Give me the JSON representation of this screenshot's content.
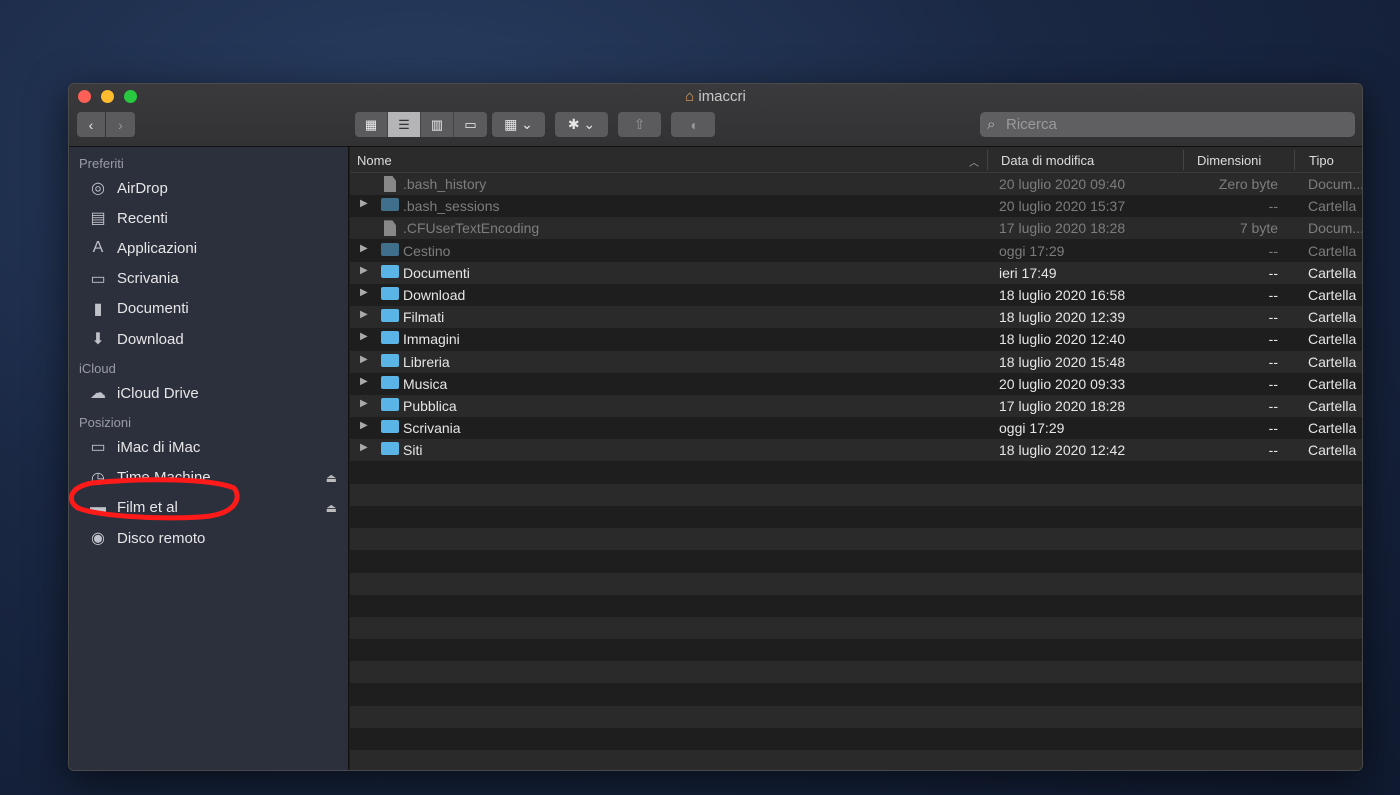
{
  "window": {
    "title": "imaccri",
    "icon": "home-icon"
  },
  "toolbar": {
    "back": "‹",
    "forward": "›",
    "views": [
      "icon-view-icon",
      "list-view-icon",
      "column-view-icon",
      "gallery-view-icon"
    ],
    "group": "group-icon",
    "action": "gear-icon",
    "share": "share-icon",
    "tag": "tag-icon",
    "search_placeholder": "Ricerca"
  },
  "sidebar": {
    "sections": [
      {
        "title": "Preferiti",
        "items": [
          {
            "label": "AirDrop",
            "icon": "airdrop-icon"
          },
          {
            "label": "Recenti",
            "icon": "recent-icon"
          },
          {
            "label": "Applicazioni",
            "icon": "applications-icon"
          },
          {
            "label": "Scrivania",
            "icon": "desktop-icon"
          },
          {
            "label": "Documenti",
            "icon": "document-icon"
          },
          {
            "label": "Download",
            "icon": "download-icon"
          }
        ]
      },
      {
        "title": "iCloud",
        "items": [
          {
            "label": "iCloud Drive",
            "icon": "cloud-icon"
          }
        ]
      },
      {
        "title": "Posizioni",
        "items": [
          {
            "label": "iMac di iMac",
            "icon": "imac-icon"
          },
          {
            "label": "Time Machine",
            "icon": "time-machine-icon",
            "eject": true
          },
          {
            "label": "Film et al",
            "icon": "drive-icon",
            "eject": true
          },
          {
            "label": "Disco remoto",
            "icon": "disc-icon"
          }
        ]
      }
    ]
  },
  "columns": {
    "name": "Nome",
    "date": "Data di modifica",
    "size": "Dimensioni",
    "kind": "Tipo"
  },
  "files": [
    {
      "name": ".bash_history",
      "date": "20 luglio 2020 09:40",
      "size": "Zero byte",
      "kind": "Docum...",
      "folder": false,
      "hidden": true
    },
    {
      "name": ".bash_sessions",
      "date": "20 luglio 2020 15:37",
      "size": "--",
      "kind": "Cartella",
      "folder": true,
      "hidden": true
    },
    {
      "name": ".CFUserTextEncoding",
      "date": "17 luglio 2020 18:28",
      "size": "7 byte",
      "kind": "Docum...",
      "folder": false,
      "hidden": true
    },
    {
      "name": "Cestino",
      "date": "oggi 17:29",
      "size": "--",
      "kind": "Cartella",
      "folder": true,
      "hidden": true
    },
    {
      "name": "Documenti",
      "date": "ieri 17:49",
      "size": "--",
      "kind": "Cartella",
      "folder": true
    },
    {
      "name": "Download",
      "date": "18 luglio 2020 16:58",
      "size": "--",
      "kind": "Cartella",
      "folder": true
    },
    {
      "name": "Filmati",
      "date": "18 luglio 2020 12:39",
      "size": "--",
      "kind": "Cartella",
      "folder": true
    },
    {
      "name": "Immagini",
      "date": "18 luglio 2020 12:40",
      "size": "--",
      "kind": "Cartella",
      "folder": true
    },
    {
      "name": "Libreria",
      "date": "18 luglio 2020 15:48",
      "size": "--",
      "kind": "Cartella",
      "folder": true
    },
    {
      "name": "Musica",
      "date": "20 luglio 2020 09:33",
      "size": "--",
      "kind": "Cartella",
      "folder": true
    },
    {
      "name": "Pubblica",
      "date": "17 luglio 2020 18:28",
      "size": "--",
      "kind": "Cartella",
      "folder": true
    },
    {
      "name": "Scrivania",
      "date": "oggi 17:29",
      "size": "--",
      "kind": "Cartella",
      "folder": true
    },
    {
      "name": "Siti",
      "date": "18 luglio 2020 12:42",
      "size": "--",
      "kind": "Cartella",
      "folder": true
    }
  ],
  "annotation": {
    "color": "#ff1a1a",
    "target": "Time Machine"
  }
}
